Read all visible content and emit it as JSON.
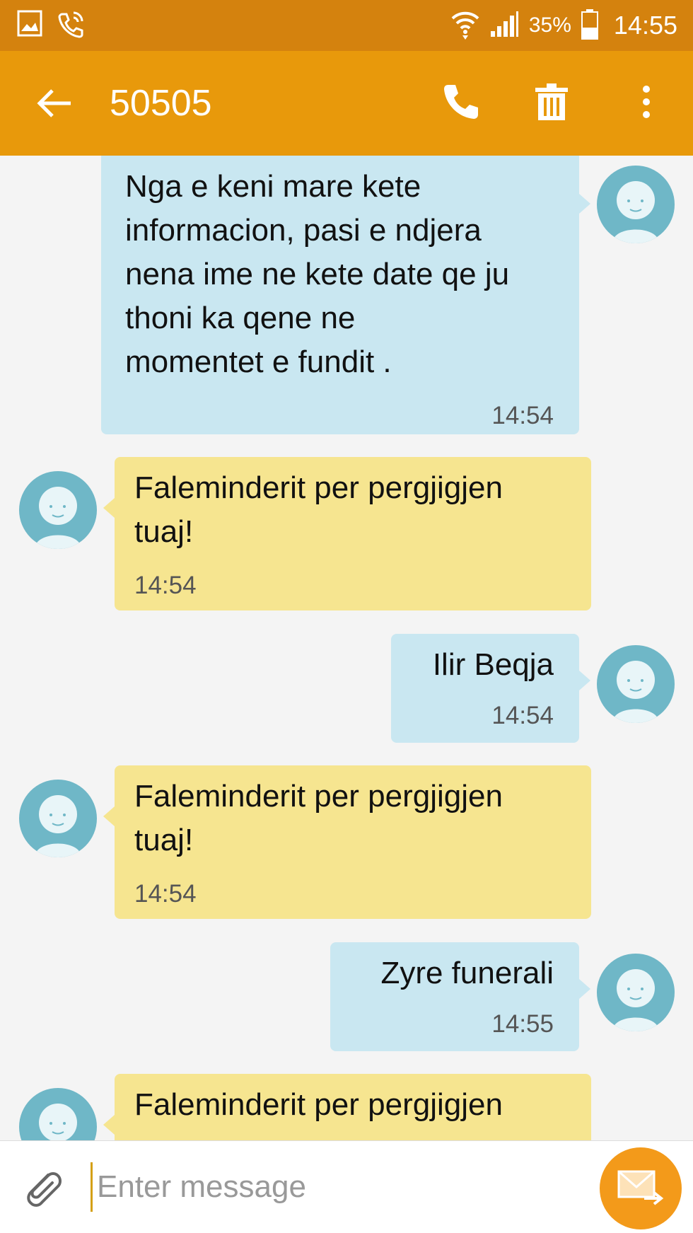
{
  "status_bar": {
    "battery": "35%",
    "time": "14:55"
  },
  "header": {
    "title": "50505"
  },
  "messages": [
    {
      "direction": "sent",
      "text": "Nga e keni mare kete\ninformacion, pasi e ndjera\nnena ime ne kete date qe ju\nthoni ka qene ne\nmomentet e fundit .",
      "time": "14:54"
    },
    {
      "direction": "received",
      "text": "Faleminderit per pergjigjen\ntuaj!",
      "time": "14:54"
    },
    {
      "direction": "sent",
      "text": "Ilir Beqja",
      "time": "14:54"
    },
    {
      "direction": "received",
      "text": "Faleminderit per pergjigjen\ntuaj!",
      "time": "14:54"
    },
    {
      "direction": "sent",
      "text": "Zyre funerali",
      "time": "14:55"
    },
    {
      "direction": "received",
      "text": "Faleminderit per pergjigjen",
      "time": ""
    }
  ],
  "composer": {
    "placeholder": "Enter message"
  },
  "colors": {
    "status_bar": "#d4820e",
    "app_bar": "#e8990b",
    "sent_bubble": "#c9e7f1",
    "received_bubble": "#f6e590",
    "avatar": "#6fb7c7",
    "send_button": "#f39a1a"
  },
  "icons": {
    "status_left": [
      "gallery-notification-icon",
      "call-notification-icon"
    ],
    "status_right": [
      "wifi-icon",
      "signal-icon",
      "battery-icon"
    ],
    "app_bar": [
      "back-arrow-icon",
      "phone-icon",
      "trash-icon",
      "more-vert-icon"
    ],
    "composer": [
      "paperclip-icon",
      "send-message-icon"
    ]
  }
}
